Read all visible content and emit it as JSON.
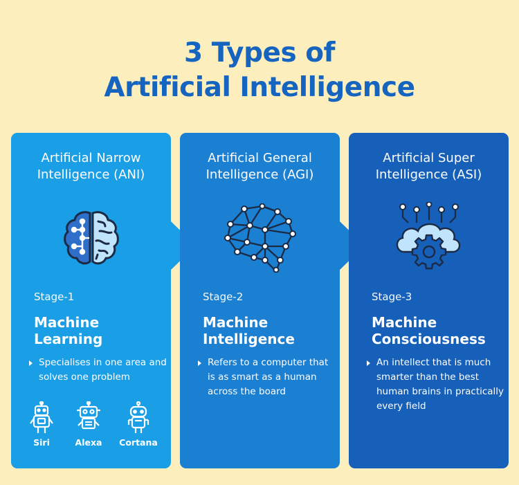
{
  "title": {
    "line1": "3 Types of",
    "line2": "Artificial Intelligence"
  },
  "cards": [
    {
      "title_line1": "Artificial Narrow",
      "title_line2": "Intelligence (ANI)",
      "icon": "brain-circuit-icon",
      "stage": "Stage-1",
      "name_line1": "Machine",
      "name_line2": "Learning",
      "description": "Specialises in one area and solves one problem",
      "examples": [
        "Siri",
        "Alexa",
        "Cortana"
      ]
    },
    {
      "title_line1": "Artificial General",
      "title_line2": "Intelligence (AGI)",
      "icon": "neural-network-brain-icon",
      "stage": "Stage-2",
      "name_line1": "Machine",
      "name_line2": "Intelligence",
      "description": "Refers to a computer that is as smart as a human across the board"
    },
    {
      "title_line1": "Artificial Super",
      "title_line2": "Intelligence (ASI)",
      "icon": "cloud-gear-icon",
      "stage": "Stage-3",
      "name_line1": "Machine",
      "name_line2": "Consciousness",
      "description": "An intellect that is much smarter than the best human brains in practically every field"
    }
  ],
  "colors": {
    "background": "#fdeebd",
    "title": "#1565c0",
    "card1": "#1a9ee6",
    "card2": "#1b7fd2",
    "card3": "#1660b9"
  }
}
